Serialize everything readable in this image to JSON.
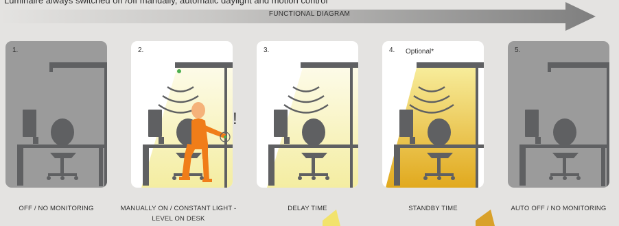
{
  "subtitle": "Luminaire always switched on /off manually, automatic daylight and motion control",
  "arrow_label": "FUNCTIONAL DIAGRAM",
  "panels": [
    {
      "number": "1.",
      "caption": "OFF / NO MONITORING"
    },
    {
      "number": "2.",
      "caption": "MANUALLY ON / CONSTANT LIGHT - LEVEL ON DESK",
      "exclamation": "!"
    },
    {
      "number": "3.",
      "caption": "DELAY TIME"
    },
    {
      "number": "4.",
      "caption": "STANDBY  TIME",
      "note": "Optional*"
    },
    {
      "number": "5.",
      "caption": "AUTO OFF / NO MONITORING"
    }
  ],
  "colors": {
    "background": "#e4e3e1",
    "panel_off": "#9b9b9b",
    "panel_on": "#ffffff",
    "furniture": "#5f6062",
    "person": "#f07d19",
    "light_pale": "#f7f2b8",
    "light_gold": "#e1a91e",
    "sensor": "#4caf50"
  }
}
